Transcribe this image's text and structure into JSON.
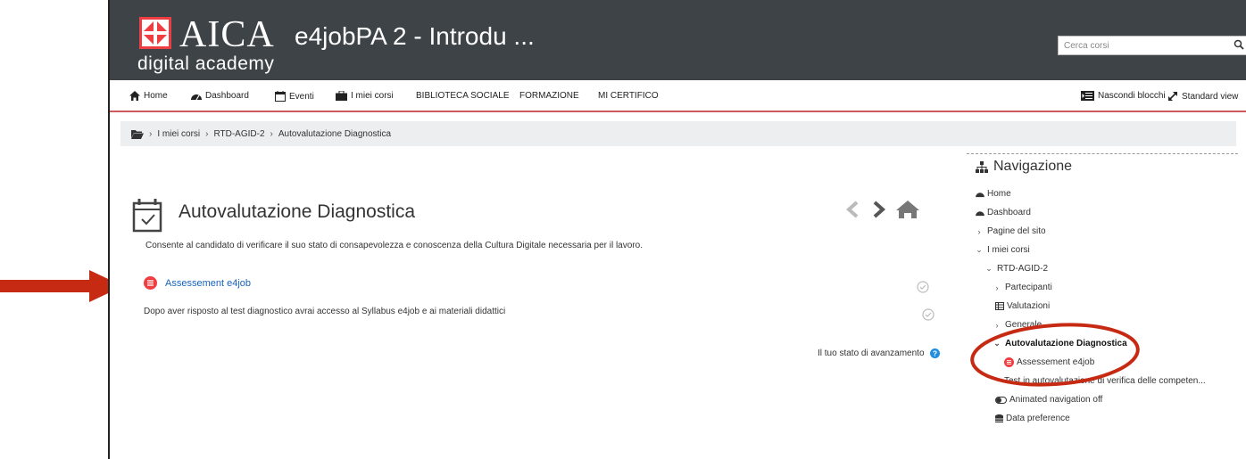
{
  "brand": {
    "logo_text": "AICA",
    "logo_subtext": "digital academy",
    "accent_color": "#ef3e42",
    "header_color": "#3d4347"
  },
  "site_title": "e4jobPA 2 - Introdu ...",
  "search": {
    "placeholder": "Cerca corsi",
    "value": ""
  },
  "nav": {
    "home": "Home",
    "dashboard": "Dashboard",
    "eventi": "Eventi",
    "miei_corsi": "I miei corsi",
    "biblioteca": "BIBLIOTECA SOCIALE",
    "formazione": "FORMAZIONE",
    "certifico": "MI CERTIFICO",
    "nascondi": "Nascondi blocchi",
    "standard_view": "Standard view"
  },
  "breadcrumb": [
    "I miei corsi",
    "RTD-AGID-2",
    "Autovalutazione Diagnostica"
  ],
  "activity": {
    "title": "Autovalutazione Diagnostica",
    "description": "Consente al candidato di verificare il suo stato di consapevolezza e conoscenza della Cultura Digitale necessaria per il lavoro.",
    "link_label": "Assessement e4job",
    "note": "Dopo aver risposto al test diagnostico avrai accesso al Syllabus e4job e ai materiali didattici",
    "progress_label": "Il tuo stato di avanzamento"
  },
  "navigation_block": {
    "title": "Navigazione",
    "items": {
      "home": "Home",
      "dashboard": "Dashboard",
      "pagine": "Pagine del sito",
      "miei_corsi": "I miei corsi",
      "course": "RTD-AGID-2",
      "partecipanti": "Partecipanti",
      "valutazioni": "Valutazioni",
      "generale": "Generale",
      "autovalutazione": "Autovalutazione Diagnostica",
      "assessment": "Assessement e4job",
      "test": "Test in autovalutazione di verifica delle competen...",
      "animated": "Animated navigation off",
      "data_pref": "Data preference"
    }
  },
  "annotation_color": "#c62a12"
}
